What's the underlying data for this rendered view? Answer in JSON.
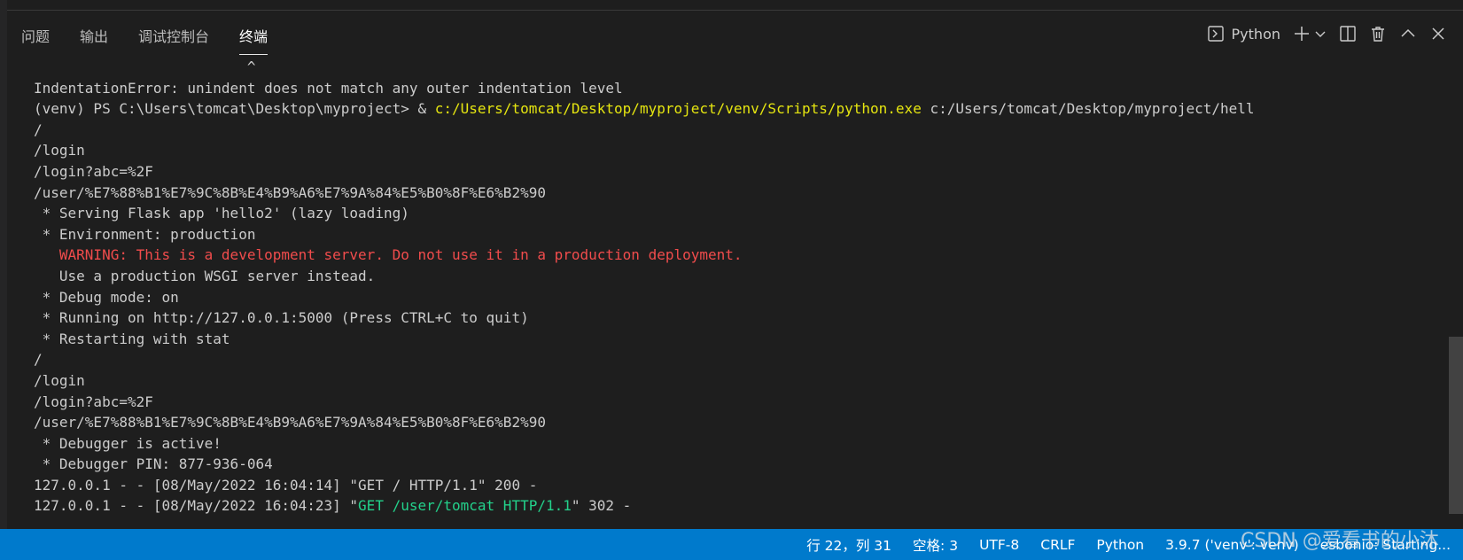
{
  "panel": {
    "tabs": [
      {
        "label": "问题"
      },
      {
        "label": "输出"
      },
      {
        "label": "调试控制台"
      },
      {
        "label": "终端",
        "active": true
      }
    ],
    "toolbar": {
      "terminal_label": "Python"
    }
  },
  "terminal": {
    "lines": [
      [
        {
          "text": "                         ^",
          "color": "default"
        }
      ],
      [
        {
          "text": "IndentationError: unindent does not match any outer indentation level",
          "color": "default"
        }
      ],
      [
        {
          "text": "(venv) PS C:\\Users\\tomcat\\Desktop\\myproject> & ",
          "color": "default"
        },
        {
          "text": "c:/Users/tomcat/Desktop/myproject/venv/Scripts/python.exe",
          "color": "yellow"
        },
        {
          "text": " c:/Users/tomcat/Desktop/myproject/hell",
          "color": "default"
        }
      ],
      [
        {
          "text": "/",
          "color": "default"
        }
      ],
      [
        {
          "text": "/login",
          "color": "default"
        }
      ],
      [
        {
          "text": "/login?abc=%2F",
          "color": "default"
        }
      ],
      [
        {
          "text": "/user/%E7%88%B1%E7%9C%8B%E4%B9%A6%E7%9A%84%E5%B0%8F%E6%B2%90",
          "color": "default"
        }
      ],
      [
        {
          "text": " * Serving Flask app 'hello2' (lazy loading)",
          "color": "default"
        }
      ],
      [
        {
          "text": " * Environment: production",
          "color": "default"
        }
      ],
      [
        {
          "text": "   WARNING: This is a development server. Do not use it in a production deployment.",
          "color": "red"
        }
      ],
      [
        {
          "text": "   Use a production WSGI server instead.",
          "color": "default"
        }
      ],
      [
        {
          "text": " * Debug mode: on",
          "color": "default"
        }
      ],
      [
        {
          "text": " * Running on http://127.0.0.1:5000 (Press CTRL+C to quit)",
          "color": "default"
        }
      ],
      [
        {
          "text": " * Restarting with stat",
          "color": "default"
        }
      ],
      [
        {
          "text": "/",
          "color": "default"
        }
      ],
      [
        {
          "text": "/login",
          "color": "default"
        }
      ],
      [
        {
          "text": "/login?abc=%2F",
          "color": "default"
        }
      ],
      [
        {
          "text": "/user/%E7%88%B1%E7%9C%8B%E4%B9%A6%E7%9A%84%E5%B0%8F%E6%B2%90",
          "color": "default"
        }
      ],
      [
        {
          "text": " * Debugger is active!",
          "color": "default"
        }
      ],
      [
        {
          "text": " * Debugger PIN: 877-936-064",
          "color": "default"
        }
      ],
      [
        {
          "text": "127.0.0.1 - - [08/May/2022 16:04:14] \"GET / HTTP/1.1\" 200 -",
          "color": "default"
        }
      ],
      [
        {
          "text": "127.0.0.1 - - [08/May/2022 16:04:23] \"",
          "color": "default"
        },
        {
          "text": "GET /user/tomcat HTTP/1.1",
          "color": "green"
        },
        {
          "text": "\" 302 -",
          "color": "default"
        }
      ]
    ]
  },
  "statusbar": {
    "position": "行 22，列 31",
    "indent": "空格: 3",
    "encoding": "UTF-8",
    "eol": "CRLF",
    "language": "Python",
    "interpreter": "3.9.7 ('venv': venv)",
    "extension": "esbonio: Starting..."
  },
  "watermark": "CSDN @爱看书的小沐",
  "colors": {
    "background": "#1e1e1e",
    "statusbar": "#007acc",
    "yellow": "#e5e510",
    "red": "#f14c4c",
    "green": "#23d18b"
  },
  "icons": [
    "terminal-icon",
    "plus-icon",
    "chevron-down-icon",
    "split-icon",
    "trash-icon",
    "chevron-up-icon",
    "close-icon"
  ]
}
